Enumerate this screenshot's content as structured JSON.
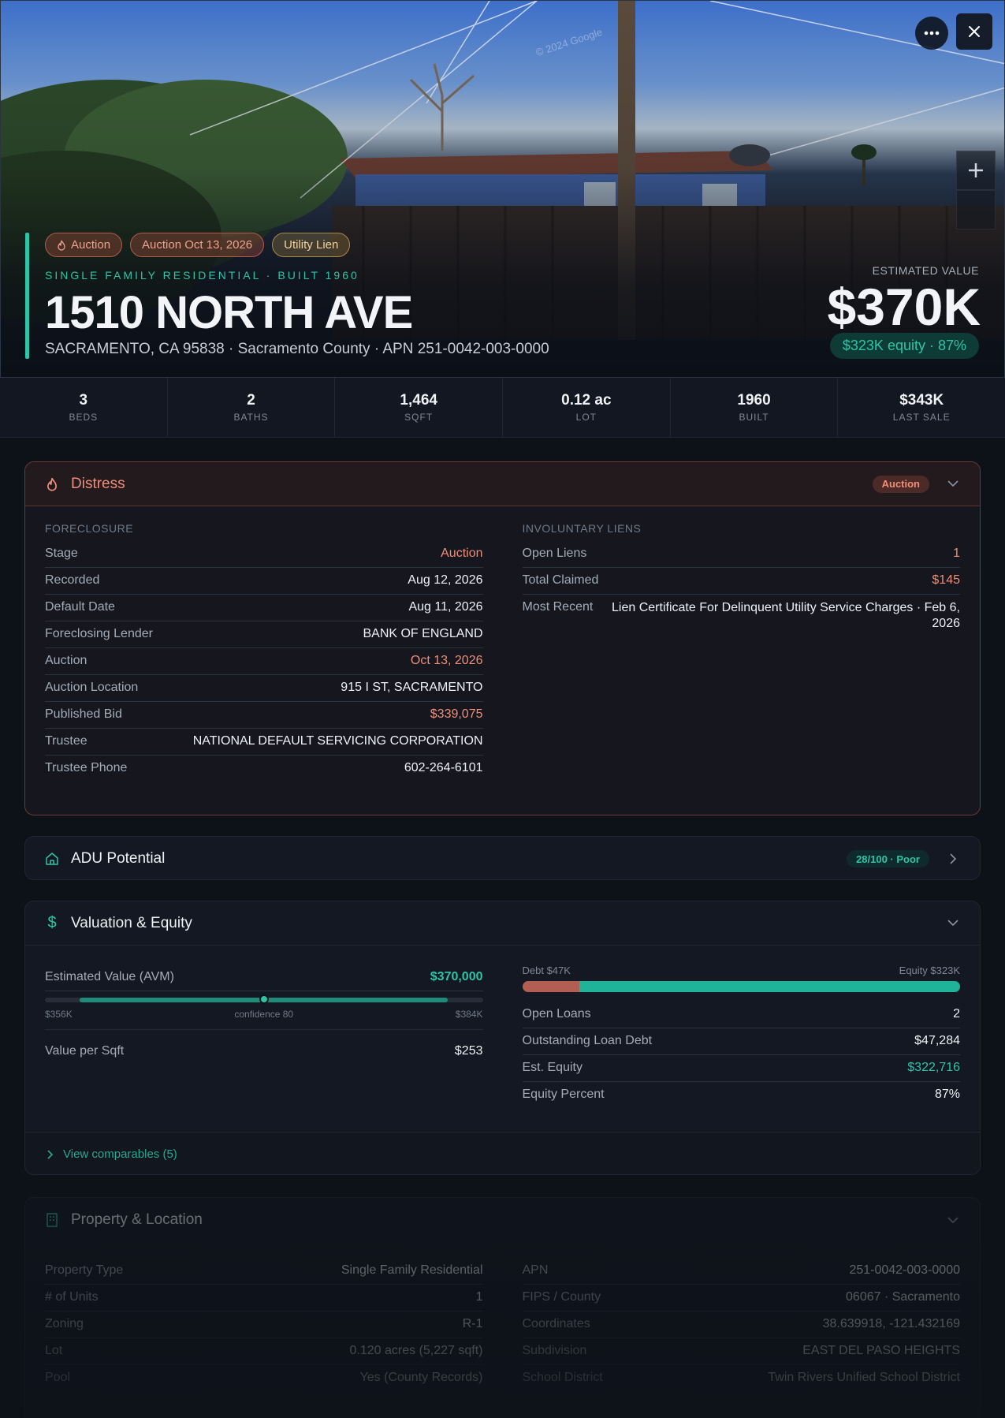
{
  "hero": {
    "watermark": "© 2024 Google",
    "badges": [
      {
        "label": "Auction",
        "icon": "flame-icon",
        "kind": "auction"
      },
      {
        "label": "Auction Oct 13, 2026",
        "kind": "auction"
      },
      {
        "label": "Utility Lien",
        "kind": "utility"
      }
    ],
    "subtitle": "SINGLE FAMILY RESIDENTIAL · BUILT 1960",
    "title": "1510 NORTH AVE",
    "address": "SACRAMENTO, CA 95838 · Sacramento County · APN 251-0042-003-0000",
    "estimated_label": "ESTIMATED VALUE",
    "estimated_value": "$370K",
    "equity_pill": "$323K equity · 87%"
  },
  "stats": [
    {
      "value": "3",
      "label": "BEDS"
    },
    {
      "value": "2",
      "label": "BATHS"
    },
    {
      "value": "1,464",
      "label": "SQFT"
    },
    {
      "value": "0.12 ac",
      "label": "LOT"
    },
    {
      "value": "1960",
      "label": "BUILT"
    },
    {
      "value": "$343K",
      "label": "LAST SALE"
    }
  ],
  "distress": {
    "title": "Distress",
    "badge": "Auction",
    "foreclosure": {
      "label": "FORECLOSURE",
      "rows": [
        {
          "k": "Stage",
          "v": "Auction",
          "tone": "orange"
        },
        {
          "k": "Recorded",
          "v": "Aug 12, 2026"
        },
        {
          "k": "Default Date",
          "v": "Aug 11, 2026"
        },
        {
          "k": "Foreclosing Lender",
          "v": "BANK OF ENGLAND"
        },
        {
          "k": "Auction",
          "v": "Oct 13, 2026",
          "tone": "orange"
        },
        {
          "k": "Auction Location",
          "v": "915 I ST, SACRAMENTO"
        },
        {
          "k": "Published Bid",
          "v": "$339,075",
          "tone": "orange"
        },
        {
          "k": "Trustee",
          "v": "NATIONAL DEFAULT SERVICING CORPORATION"
        },
        {
          "k": "Trustee Phone",
          "v": "602-264-6101"
        }
      ]
    },
    "liens": {
      "label": "INVOLUNTARY LIENS",
      "rows": [
        {
          "k": "Open Liens",
          "v": "1",
          "tone": "orange"
        },
        {
          "k": "Total Claimed",
          "v": "$145",
          "tone": "orange"
        },
        {
          "k": "Most Recent",
          "v": "Lien Certificate For Delinquent Utility Service Charges · Feb 6, 2026"
        }
      ]
    }
  },
  "adu": {
    "title": "ADU Potential",
    "badge": "28/100 · Poor"
  },
  "valuation": {
    "title": "Valuation & Equity",
    "avm_label": "Estimated Value (AVM)",
    "avm_value": "$370,000",
    "avm_low": "$356K",
    "avm_conf": "confidence 80",
    "avm_high": "$384K",
    "avm_range_fraction": [
      0.08,
      0.92
    ],
    "avm_point_fraction": 0.5,
    "per_sqft_label": "Value per Sqft",
    "per_sqft_value": "$253",
    "debt_label": "Debt $47K",
    "equity_label": "Equity $323K",
    "debt_fraction": 0.13,
    "rows": [
      {
        "k": "Open Loans",
        "v": "2"
      },
      {
        "k": "Outstanding Loan Debt",
        "v": "$47,284"
      },
      {
        "k": "Est. Equity",
        "v": "$322,716",
        "tone": "teal"
      },
      {
        "k": "Equity Percent",
        "v": "87%"
      }
    ],
    "comps": "View comparables (5)"
  },
  "property": {
    "title": "Property & Location",
    "left": [
      {
        "k": "Property Type",
        "v": "Single Family Residential"
      },
      {
        "k": "# of Units",
        "v": "1"
      },
      {
        "k": "Zoning",
        "v": "R-1"
      },
      {
        "k": "Lot",
        "v": "0.120 acres (5,227 sqft)"
      },
      {
        "k": "Pool",
        "v": "Yes (County Records)"
      }
    ],
    "right": [
      {
        "k": "APN",
        "v": "251-0042-003-0000"
      },
      {
        "k": "FIPS / County",
        "v": "06067 · Sacramento"
      },
      {
        "k": "Coordinates",
        "v": "38.639918, -121.432169"
      },
      {
        "k": "Subdivision",
        "v": "EAST DEL PASO HEIGHTS"
      },
      {
        "k": "School District",
        "v": "Twin Rivers Unified School District"
      }
    ]
  },
  "colors": {
    "accent": "#2ec4a8",
    "danger": "#f08e78",
    "bg": "#0d1118"
  }
}
